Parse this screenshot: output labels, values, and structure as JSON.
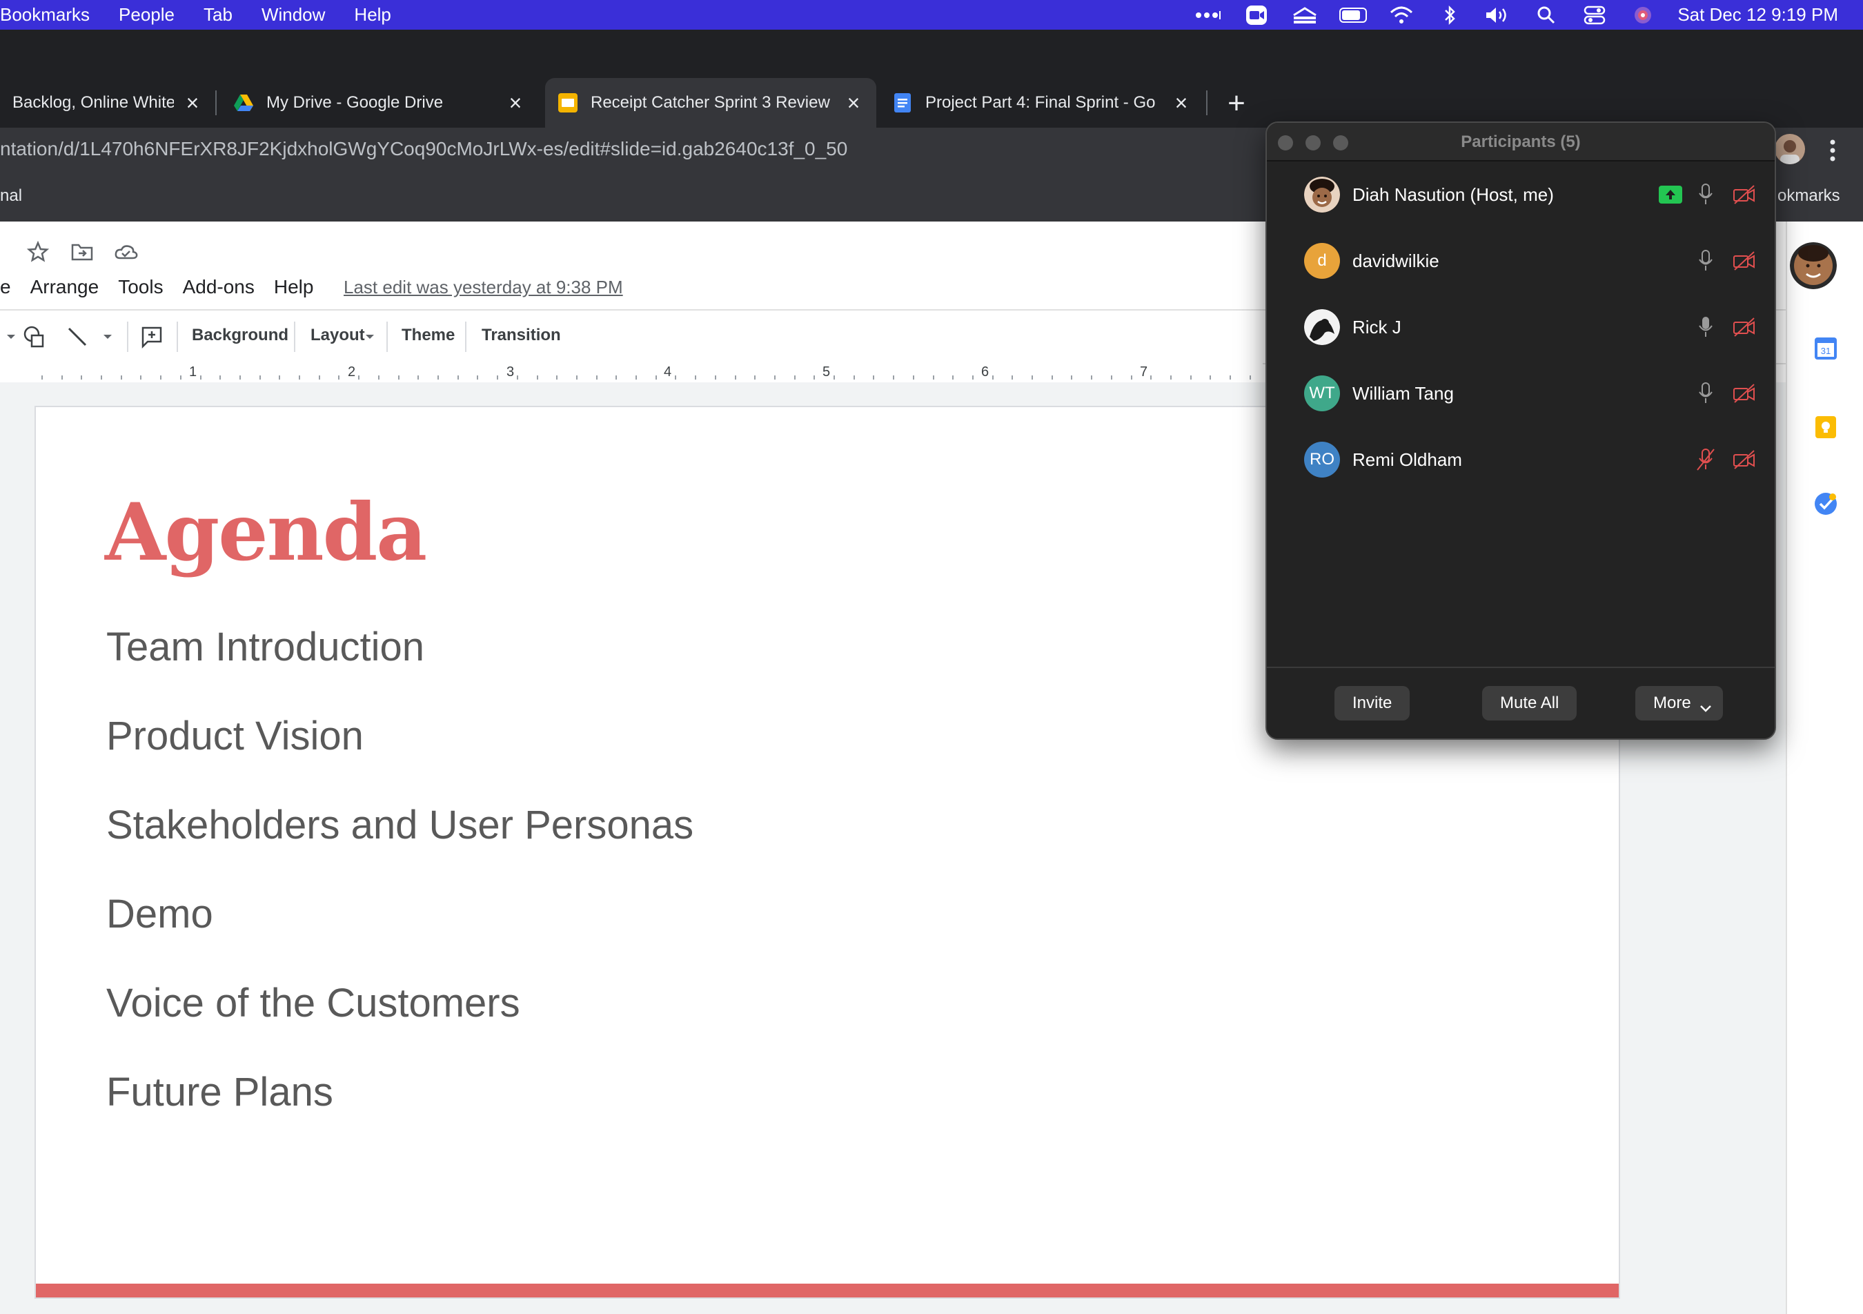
{
  "menubar": {
    "items": [
      "Bookmarks",
      "People",
      "Tab",
      "Window",
      "Help"
    ],
    "clock": "Sat Dec 12  9:19 PM",
    "status_icons": [
      "dots-icon",
      "zoom-icon",
      "stack-icon",
      "battery-icon",
      "wifi-icon",
      "bluetooth-icon",
      "volume-icon",
      "search-icon",
      "control-center-icon",
      "siri-icon"
    ]
  },
  "browser": {
    "tabs": [
      {
        "label": "Backlog, Online Whitel",
        "favicon": "miro-icon"
      },
      {
        "label": "My Drive - Google Drive",
        "favicon": "google-drive-icon"
      },
      {
        "label": "Receipt Catcher Sprint 3 Review",
        "favicon": "google-slides-icon",
        "active": true
      },
      {
        "label": "Project Part 4: Final Sprint - Go",
        "favicon": "google-docs-icon"
      }
    ],
    "url": "ntation/d/1L470h6NFErXR8JF2KjdxholGWgYCoq90cMoJrLWx-es/edit#slide=id.gab2640c13f_0_50",
    "bookmark_left": "nal",
    "bookmark_right": "okmarks"
  },
  "slides_app": {
    "menus": [
      "e",
      "Arrange",
      "Tools",
      "Add-ons",
      "Help"
    ],
    "last_edit": "Last edit was yesterday at 9:38 PM",
    "toolbar": {
      "background": "Background",
      "layout": "Layout",
      "theme": "Theme",
      "transition": "Transition"
    },
    "ruler_numbers": [
      "1",
      "2",
      "3",
      "4",
      "5",
      "6",
      "7"
    ]
  },
  "slide": {
    "title": "Agenda",
    "items": [
      "Team Introduction",
      "Product Vision",
      "Stakeholders and User Personas",
      "Demo",
      "Voice of the Customers",
      "Future Plans"
    ],
    "accent_color": "#e06666"
  },
  "zoom": {
    "title": "Participants (5)",
    "participants": [
      {
        "name": "Diah Nasution (Host, me)",
        "avatar": "photo",
        "initials": "",
        "avatar_color": "#a0522d",
        "sharing": true,
        "mic_muted": false,
        "video_off": true
      },
      {
        "name": "davidwilkie",
        "avatar": "initials",
        "initials": "d",
        "avatar_color": "#e8a33a",
        "sharing": false,
        "mic_muted": false,
        "video_off": true
      },
      {
        "name": "Rick J",
        "avatar": "photo",
        "initials": "",
        "avatar_color": "#333333",
        "sharing": false,
        "mic_muted": false,
        "video_off": true
      },
      {
        "name": "William Tang",
        "avatar": "initials",
        "initials": "WT",
        "avatar_color": "#3fa88a",
        "sharing": false,
        "mic_muted": false,
        "video_off": true
      },
      {
        "name": "Remi Oldham",
        "avatar": "initials",
        "initials": "RO",
        "avatar_color": "#3f82c4",
        "sharing": false,
        "mic_muted": true,
        "video_off": true
      }
    ],
    "buttons": {
      "invite": "Invite",
      "mute_all": "Mute All",
      "more": "More"
    }
  }
}
